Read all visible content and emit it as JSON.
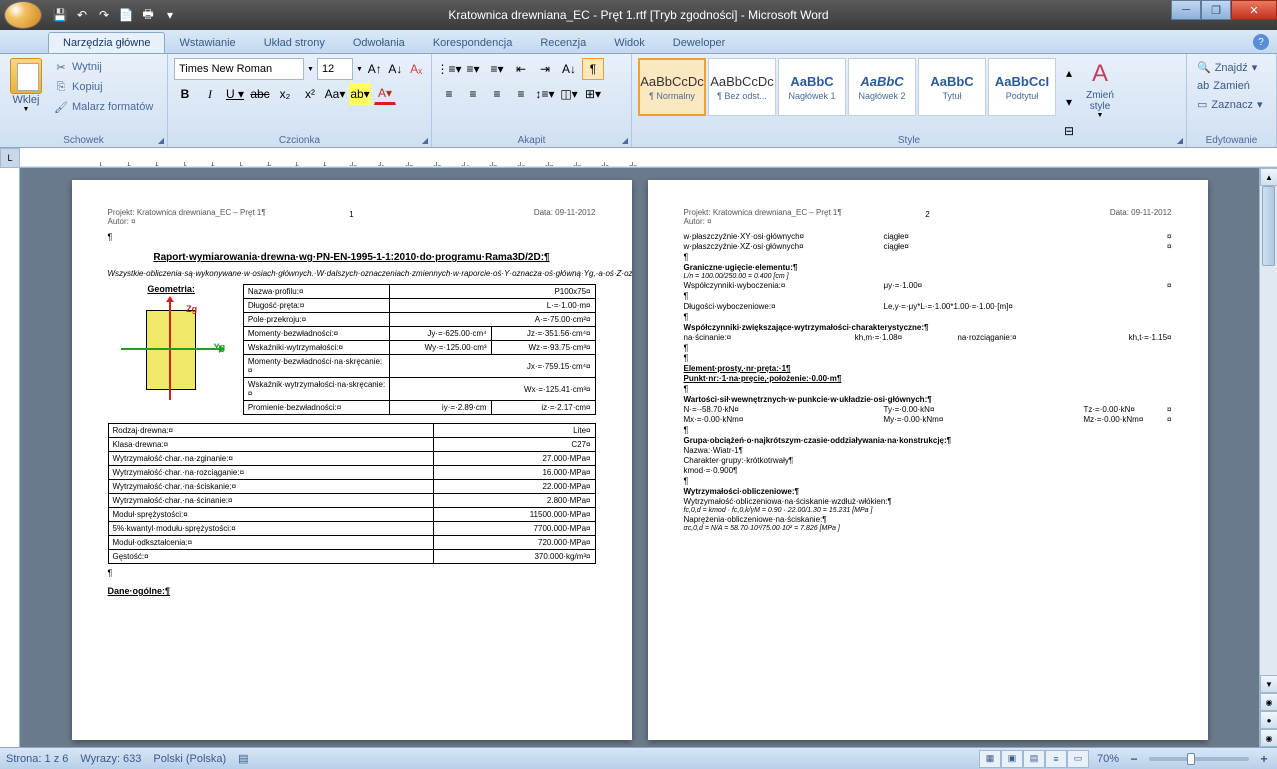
{
  "window": {
    "title": "Kratownica drewniana_EC - Pręt 1.rtf [Tryb zgodności] - Microsoft Word"
  },
  "tabs": {
    "home": "Narzędzia główne",
    "insert": "Wstawianie",
    "layout": "Układ strony",
    "references": "Odwołania",
    "mail": "Korespondencja",
    "review": "Recenzja",
    "view": "Widok",
    "developer": "Deweloper"
  },
  "ribbon": {
    "clipboard": {
      "label": "Schowek",
      "paste": "Wklej",
      "cut": "Wytnij",
      "copy": "Kopiuj",
      "painter": "Malarz formatów"
    },
    "font": {
      "label": "Czcionka",
      "name": "Times New Roman",
      "size": "12"
    },
    "paragraph": {
      "label": "Akapit"
    },
    "styles": {
      "label": "Style",
      "preview": "AaBbCcDc",
      "preview_h": "AaBbC",
      "preview_sub": "AaBbCcI",
      "normal": "¶ Normalny",
      "nospacing": "¶ Bez odst...",
      "heading1": "Nagłówek 1",
      "heading2": "Nagłówek 2",
      "title": "Tytuł",
      "subtitle": "Podtytuł",
      "change": "Zmień style"
    },
    "editing": {
      "label": "Edytowanie",
      "find": "Znajdź",
      "replace": "Zamień",
      "select": "Zaznacz"
    }
  },
  "status": {
    "page": "Strona: 1 z 6",
    "words": "Wyrazy: 633",
    "lang": "Polski (Polska)",
    "zoom": "70%"
  },
  "doc": {
    "header_project": "Projekt: Kratownica drewniana_EC – Pręt 1¶",
    "header_author": "Autor: ¤",
    "header_date": "Data: 09-11-2012",
    "page1_num": "1",
    "page2_num": "2",
    "title": "Raport·wymiarowania·drewna·wg·PN-EN-1995-1-1:2010·do·programu·Rama3D/2D:¶",
    "note": "Wszystkie·obliczenia·są·wykonywane·w·osiach·głównych.·W·dalszych·oznaczeniach·zmiennych·w·raporcie·oś·Y·oznacza·oś·główną·Yg,·a·oś·Z·oznacza·oś·główną·Zg.¶",
    "geometry_title": "Geometria:",
    "geo_rows": [
      {
        "label": "Nazwa·profilu:¤",
        "v1": "",
        "v2": "P100x75¤"
      },
      {
        "label": "Długość·pręta:¤",
        "v1": "",
        "v2": "L·=·1.00·m¤"
      },
      {
        "label": "Pole·przekroju:¤",
        "v1": "",
        "v2": "A·=·75.00·cm²¤"
      },
      {
        "label": "Momenty·bezwładności:¤",
        "v1": "Jy·=·625.00·cm⁴",
        "v2": "Jz·=·351.56·cm⁴¤"
      },
      {
        "label": "Wskaźniki·wytrzymałości:¤",
        "v1": "Wy·=·125.00·cm³",
        "v2": "Wz·=·93.75·cm³¤"
      },
      {
        "label": "Momenty·bezwładności·na·skręcanie:¤",
        "v1": "",
        "v2": "Jx·=·759.15·cm⁴¤"
      },
      {
        "label": "Wskaźnik·wytrzymałości·na·skręcanie:¤",
        "v1": "",
        "v2": "Wx·=·125.41·cm³¤"
      },
      {
        "label": "Promienie·bezwładności:¤",
        "v1": "iy·=·2.89·cm",
        "v2": "iz·=·2.17·cm¤"
      }
    ],
    "props_rows": [
      {
        "label": "Rodzaj·drewna:¤",
        "val": "Lite¤"
      },
      {
        "label": "Klasa·drewna:¤",
        "val": "C27¤"
      },
      {
        "label": "Wytrzymałość·char.·na·zginanie:¤",
        "val": "27.000·MPa¤"
      },
      {
        "label": "Wytrzymałość·char.·na·rozciąganie:¤",
        "val": "16.000·MPa¤"
      },
      {
        "label": "Wytrzymałość·char.·na·ściskanie:¤",
        "val": "22.000·MPa¤"
      },
      {
        "label": "Wytrzymałość·char.·na·ścinanie:¤",
        "val": "2.800·MPa¤"
      },
      {
        "label": "Moduł·sprężystości:¤",
        "val": "11500.000·MPa¤"
      },
      {
        "label": "5%·kwantyl·modułu·sprężystości:¤",
        "val": "7700.000·MPa¤"
      },
      {
        "label": "Moduł·odkształcenia:¤",
        "val": "720.000·MPa¤"
      },
      {
        "label": "Gęstość:¤",
        "val": "370.000·kg/m³¤"
      }
    ],
    "dane_ogolne": "Dane·ogólne:¶",
    "p2": {
      "xy_plane": "w·płaszczyźnie·XY·osi·głównych¤",
      "xz_plane": "w·płaszczyźnie·XZ·osi·głównych¤",
      "continuous": "ciągłe¤",
      "deflection_title": "Graniczne·ugięcie·elementu:¶",
      "deflection_formula": "L/n = 100.00/250.00 = 0.400 [cm ]",
      "buckling_coef": "Współczynniki·wyboczenia:¤",
      "mu_val": "μy·=·1.00¤",
      "buckling_len": "Długości·wyboczeniowe:¤",
      "len_val": "Le,y·=·μy*L·=·1.00*1.00·=·1.00·[m]¤",
      "coef_increase": "Współczynniki·zwiększające·wytrzymałości·charakterystyczne:¶",
      "shear_label": "na·ścinanie:¤",
      "kh_m": "kh,m·=·1.08¤",
      "tension_label": "na·rozciąganie:¤",
      "kh_t": "kh,t·=·1.15¤",
      "element_title": "Element·prosty,·nr·pręta:·1¶",
      "point_title": "Punkt·nr:·1·na·pręcie,·położenie:·0.00·m¶",
      "forces_title": "Wartości·sił·wewnętrznych·w·punkcie·w·układzie·osi·głównych:¶",
      "N": "N·=·-58.70·kN¤",
      "Ty": "Ty·=·0.00·kN¤",
      "Tz": "Tz·=·0.00·kN¤",
      "Mx": "Mx·=·0.00·kNm¤",
      "My": "My·=·0.00·kNm¤",
      "Mz": "Mz·=·0.00·kNm¤",
      "loads_title": "Grupa·obciążeń·o·najkrótszym·czasie·oddziaływania·na·konstrukcję:¶",
      "load_name": "Nazwa:·Wiatr-1¶",
      "load_char": "Charakter·grupy:·krótkotrwały¶",
      "kmod": "kmod·=·0.900¶",
      "strength_title": "Wytrzymałości·obliczeniowe:¶",
      "strength_desc": "Wytrzymałość·obliczeniowa·na·ściskanie·wzdłuż·włókien:¶",
      "fcd_formula": "fc,0,d = kmod · fc,0,k/γM = 0.90 · 22.00/1.30 = 15.231 [MPa ]",
      "stress_title": "Naprężenia·obliczeniowe·na·ściskanie:¶",
      "sigma_formula": "σc,0,d = N/A = 58.70·10³/75.00·10² = 7.826 [MPa ]"
    }
  }
}
